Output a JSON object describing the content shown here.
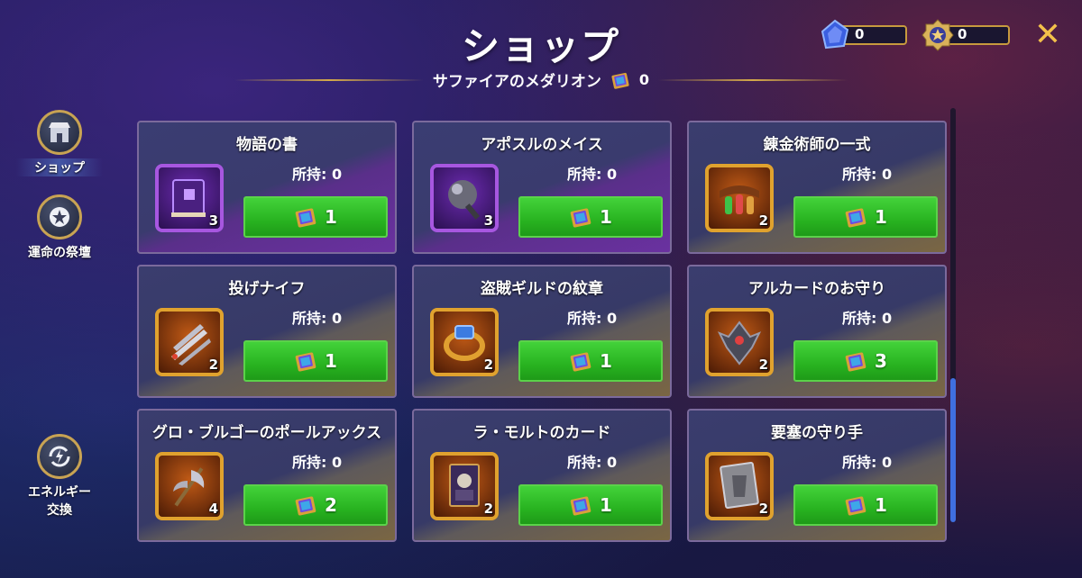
{
  "header": {
    "title": "ショップ",
    "subtitle": "サファイアのメダリオン",
    "subtitle_count": "0",
    "close_label": "✕"
  },
  "currencies": [
    {
      "name": "energy-crystal",
      "value": "0"
    },
    {
      "name": "star-medal",
      "value": "0"
    }
  ],
  "sidebar": {
    "items": [
      {
        "label": "ショップ",
        "active": true
      },
      {
        "label": "運命の祭壇",
        "active": false
      },
      {
        "label": "エネルギー交換",
        "line1": "エネルギー",
        "line2": "交換",
        "active": false
      }
    ]
  },
  "items": [
    {
      "name": "物語の書",
      "owned": "所持: 0",
      "count": "3",
      "price": "1",
      "rarity": "purple",
      "icon": "book-icon"
    },
    {
      "name": "アポスルのメイス",
      "owned": "所持: 0",
      "count": "3",
      "price": "1",
      "rarity": "purple",
      "icon": "mace-icon"
    },
    {
      "name": "錬金術師の一式",
      "owned": "所持: 0",
      "count": "2",
      "price": "1",
      "rarity": "gold",
      "icon": "potions-icon"
    },
    {
      "name": "投げナイフ",
      "owned": "所持: 0",
      "count": "2",
      "price": "1",
      "rarity": "gold",
      "icon": "knives-icon"
    },
    {
      "name": "盗賊ギルドの紋章",
      "owned": "所持: 0",
      "count": "2",
      "price": "1",
      "rarity": "gold",
      "icon": "ring-icon"
    },
    {
      "name": "アルカードのお守り",
      "owned": "所持: 0",
      "count": "2",
      "price": "3",
      "rarity": "gold",
      "icon": "amulet-icon"
    },
    {
      "name": "グロ・ブルゴーのポールアックス",
      "owned": "所持: 0",
      "count": "4",
      "price": "2",
      "rarity": "gold",
      "icon": "poleaxe-icon"
    },
    {
      "name": "ラ・モルトのカード",
      "owned": "所持: 0",
      "count": "2",
      "price": "1",
      "rarity": "gold",
      "icon": "card-icon"
    },
    {
      "name": "要塞の守り手",
      "owned": "所持: 0",
      "count": "2",
      "price": "1",
      "rarity": "gold",
      "icon": "shield-icon"
    }
  ],
  "colors": {
    "buy_green": "#2bb523",
    "gold_border": "#e0a22e",
    "purple_border": "#a757e0",
    "close": "#f3c14a"
  }
}
